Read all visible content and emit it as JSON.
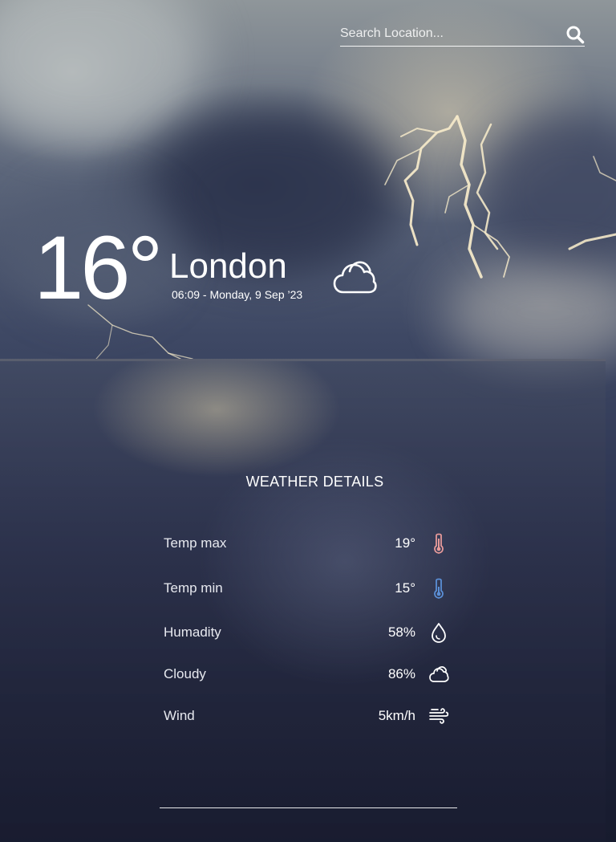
{
  "search": {
    "placeholder": "Search Location...",
    "icon": "search-icon"
  },
  "current": {
    "temperature": "16°",
    "city": "London",
    "datetime": "06:09 - Monday, 9 Sep ’23",
    "condition_icon": "cloud-icon"
  },
  "details": {
    "title": "WEATHER DETAILS",
    "rows": [
      {
        "label": "Temp max",
        "value": "19°",
        "icon": "thermometer-hot-icon",
        "icon_color": "#e79a9a"
      },
      {
        "label": "Temp min",
        "value": "15°",
        "icon": "thermometer-cold-icon",
        "icon_color": "#5b8fd6"
      },
      {
        "label": "Humadity",
        "value": "58%",
        "icon": "droplet-icon",
        "icon_color": "#ffffff"
      },
      {
        "label": "Cloudy",
        "value": "86%",
        "icon": "cloud-icon",
        "icon_color": "#ffffff"
      },
      {
        "label": "Wind",
        "value": "5km/h",
        "icon": "wind-icon",
        "icon_color": "#ffffff"
      }
    ]
  }
}
